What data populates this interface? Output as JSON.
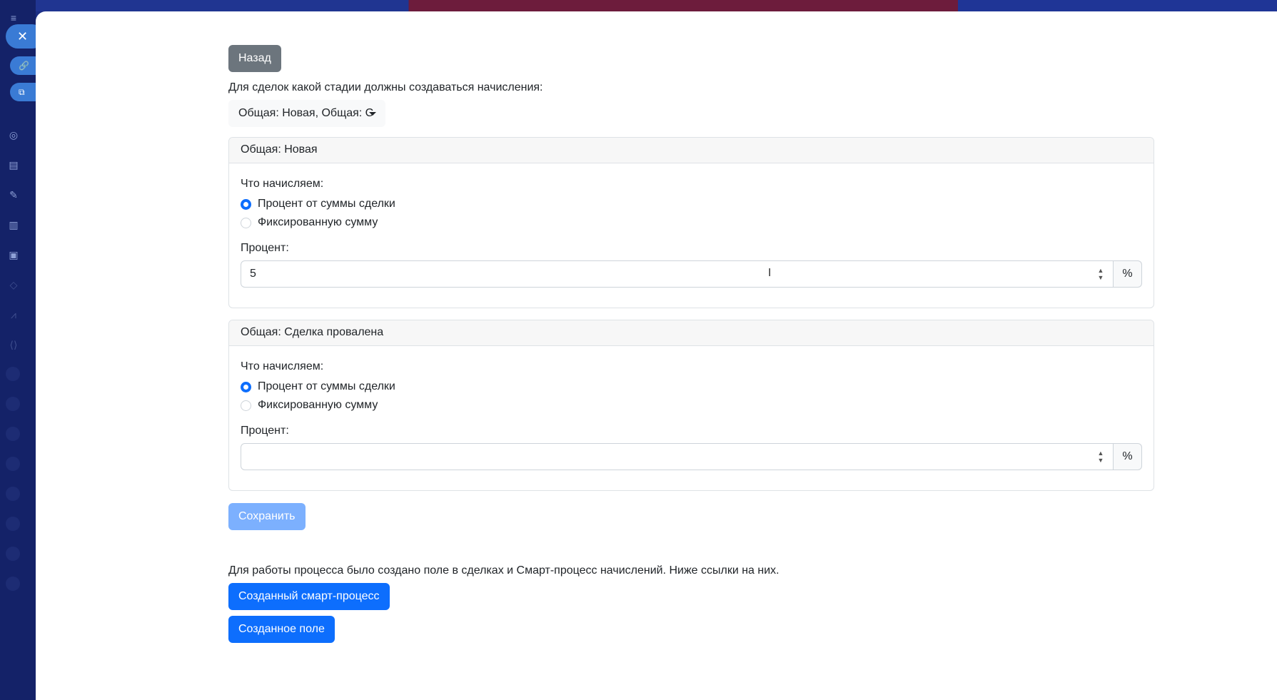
{
  "controls": {
    "close_icon": "✕",
    "link_icon": "🔗",
    "open_icon": "⧉"
  },
  "back_button": "Назад",
  "stage_prompt": "Для сделок какой стадии должны создаваться начисления:",
  "stage_select": {
    "value": "Общая: Новая, Общая: С"
  },
  "cards": [
    {
      "title": "Общая: Новая",
      "what_label": "Что начисляем:",
      "options": [
        {
          "label": "Процент от суммы сделки",
          "checked": true
        },
        {
          "label": "Фиксированную сумму",
          "checked": false
        }
      ],
      "percent_label": "Процент:",
      "percent_value": "5",
      "percent_unit": "%"
    },
    {
      "title": "Общая: Сделка провалена",
      "what_label": "Что начисляем:",
      "options": [
        {
          "label": "Процент от суммы сделки",
          "checked": true
        },
        {
          "label": "Фиксированную сумму",
          "checked": false
        }
      ],
      "percent_label": "Процент:",
      "percent_value": "",
      "percent_unit": "%"
    }
  ],
  "save_button": "Сохранить",
  "info_text": "Для работы процесса было создано поле в сделках и Смарт-процесс начислений. Ниже ссылки на них.",
  "links": {
    "smart_process": "Созданный смарт-процесс",
    "field": "Созданное поле"
  },
  "colors": {
    "primary": "#0d6efd",
    "secondary": "#6c757d",
    "primary_disabled": "#6ea8fe"
  }
}
